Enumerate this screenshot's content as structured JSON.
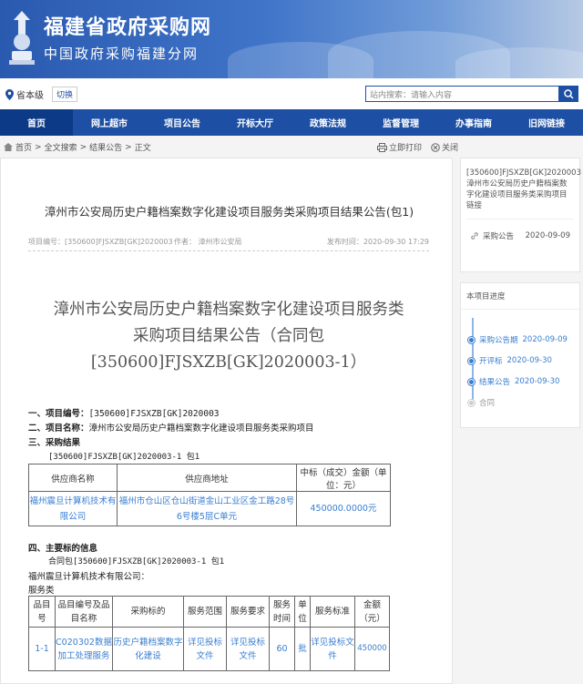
{
  "banner": {
    "title": "福建省政府采购网",
    "subtitle": "中国政府采购福建分网"
  },
  "toolbar": {
    "region": "省本级",
    "switch_label": "切换",
    "search_placeholder": "站内搜索：请输入内容"
  },
  "nav": {
    "items": [
      "首页",
      "网上超市",
      "项目公告",
      "开标大厅",
      "政策法规",
      "监督管理",
      "办事指南",
      "旧网链接"
    ],
    "active_index": 0
  },
  "breadcrumb": {
    "items": [
      "首页",
      "全文搜索",
      "结果公告",
      "正文"
    ],
    "separator": ">"
  },
  "actions": {
    "print": "立即打印",
    "close": "关闭"
  },
  "article": {
    "title": "漳州市公安局历史户籍档案数字化建设项目服务类采购项目结果公告(包1)",
    "meta_code": "项目编号：[350600]FJSXZB[GK]2020003",
    "meta_author": "作者： 漳州市公安局",
    "meta_date": "发布时间：2020-09-30 17:29",
    "big_title_lines": [
      "漳州市公安局历史户籍档案数字化建设项目服务类",
      "采购项目结果公告（合同包",
      "[350600]FJSXZB[GK]2020003-1）"
    ],
    "s1_label": "一、项目编号：",
    "s1_value": "[350600]FJSXZB[GK]2020003",
    "s2_label": "二、项目名称：",
    "s2_value": "漳州市公安局历史户籍档案数字化建设项目服务类采购项目",
    "s3_label": "三、采购结果",
    "s3_pkg": "[350600]FJSXZB[GK]2020003-1 包1",
    "t1_headers": [
      "供应商名称",
      "供应商地址",
      "中标（成交）金额（单位：元）"
    ],
    "t1_row": [
      "福州震旦计算机技术有限公司",
      "福州市仓山区仓山街道金山工业区金工路28号6号楼5层C单元",
      "450000.0000元"
    ],
    "s4_label": "四、主要标的信息",
    "s4_pkg": "合同包[350600]FJSXZB[GK]2020003-1 包1",
    "s4_company": "福州震旦计算机技术有限公司：",
    "s4_type": "服务类",
    "t2_headers": [
      "品目号",
      "品目编号及品目名称",
      "采购标的",
      "服务范围",
      "服务要求",
      "服务时间",
      "单位",
      "服务标准",
      "金额（元）"
    ],
    "t2_row": [
      "1-1",
      "C020302数据加工处理服务",
      "历史户籍档案数字化建设",
      "详见投标文件",
      "详见投标文件",
      "60",
      "批",
      "详见投标文件",
      "450000"
    ]
  },
  "sidebar": {
    "link_title": "[350600]FJSXZB[GK]2020003漳州市公安局历史户籍档案数字化建设项目服务类采购项目链接",
    "link_type": "采购公告",
    "link_date": "2020-09-09",
    "progress_title": "本项目进度",
    "progress": [
      {
        "label": "采购公告期",
        "date": "2020-09-09",
        "done": true
      },
      {
        "label": "开评标",
        "date": "2020-09-30",
        "done": true
      },
      {
        "label": "结果公告",
        "date": "2020-09-30",
        "done": true
      },
      {
        "label": "合同",
        "date": "",
        "done": false
      }
    ]
  }
}
